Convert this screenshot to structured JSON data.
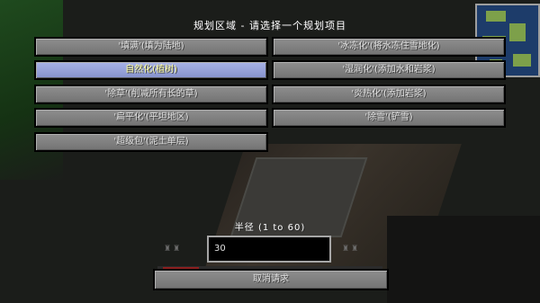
{
  "title": "规划区域 - 请选择一个规划项目",
  "options_left": [
    "'填满'(填为陆地)",
    "自然化(植树)",
    "'除草'(削减所有长的草)",
    "'扁平化'(平坦地区)",
    "'超级包'(泥土单层)"
  ],
  "options_right": [
    "'冰冻化'(将水冻住雪地化)",
    "'湿润化'(添加水和岩浆)",
    "'炎热化'(添加岩浆)",
    "'除雪'(铲雪)"
  ],
  "highlighted_option": "自然化(植树)",
  "radius": {
    "label": "半径 (1 to 60)",
    "value": "30"
  },
  "cancel_label": "取消请求",
  "colors": {
    "button": "#808080",
    "button_hover": "#97a2db",
    "text": "#e0e0e0",
    "text_hover": "#ffffa0"
  }
}
